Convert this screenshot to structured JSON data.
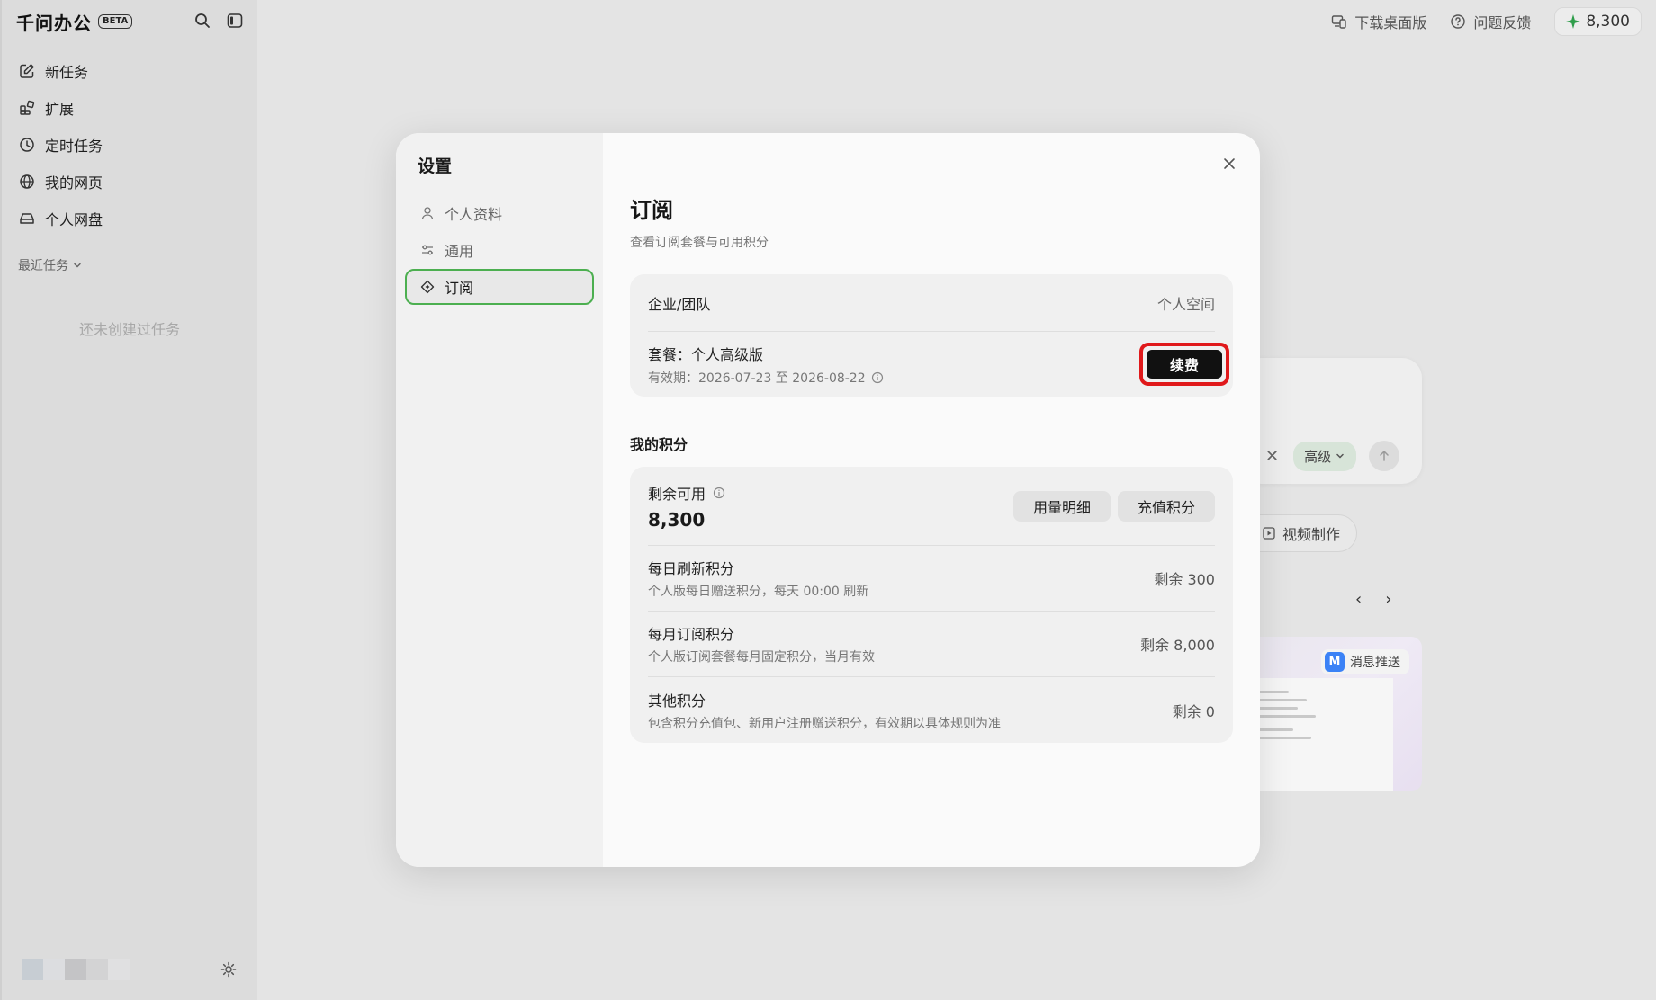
{
  "app": {
    "title": "千问办公",
    "badge": "BETA"
  },
  "sidebar": {
    "items": [
      {
        "label": "新任务",
        "icon": "edit-icon"
      },
      {
        "label": "扩展",
        "icon": "extensions-icon"
      },
      {
        "label": "定时任务",
        "icon": "clock-icon"
      },
      {
        "label": "我的网页",
        "icon": "globe-icon"
      },
      {
        "label": "个人网盘",
        "icon": "drive-icon"
      }
    ],
    "recent_label": "最近任务",
    "empty_text": "还未创建过任务"
  },
  "topbar": {
    "download_label": "下载桌面版",
    "feedback_label": "问题反馈",
    "points": "8,300"
  },
  "background": {
    "advanced_label": "高级",
    "video_label": "视频制作",
    "message_badge": "M",
    "message_label": "消息推送"
  },
  "settings": {
    "title": "设置",
    "nav": [
      {
        "label": "个人资料",
        "icon": "user-icon"
      },
      {
        "label": "通用",
        "icon": "sliders-icon"
      },
      {
        "label": "订阅",
        "icon": "diamond-icon",
        "active": true
      }
    ],
    "main": {
      "title": "订阅",
      "subtitle": "查看订阅套餐与可用积分",
      "org_label": "企业/团队",
      "space_label": "个人空间",
      "plan_label": "套餐：个人高级版",
      "validity": "有效期：2026-07-23 至 2026-08-22",
      "renew_button": "续费",
      "points_section": "我的积分",
      "remaining_label": "剩余可用",
      "remaining_value": "8,300",
      "usage_button": "用量明细",
      "topup_button": "充值积分",
      "point_rows": [
        {
          "name": "每日刷新积分",
          "desc": "个人版每日赠送积分，每天 00:00 刷新",
          "remain": "剩余 300"
        },
        {
          "name": "每月订阅积分",
          "desc": "个人版订阅套餐每月固定积分，当月有效",
          "remain": "剩余 8,000"
        },
        {
          "name": "其他积分",
          "desc": "包含积分充值包、新用户注册赠送积分，有效期以具体规则为准",
          "remain": "剩余 0"
        }
      ]
    }
  },
  "colors": {
    "accent_green": "#4caf50",
    "highlight_red": "#e0191b",
    "button_dark": "#111111"
  }
}
